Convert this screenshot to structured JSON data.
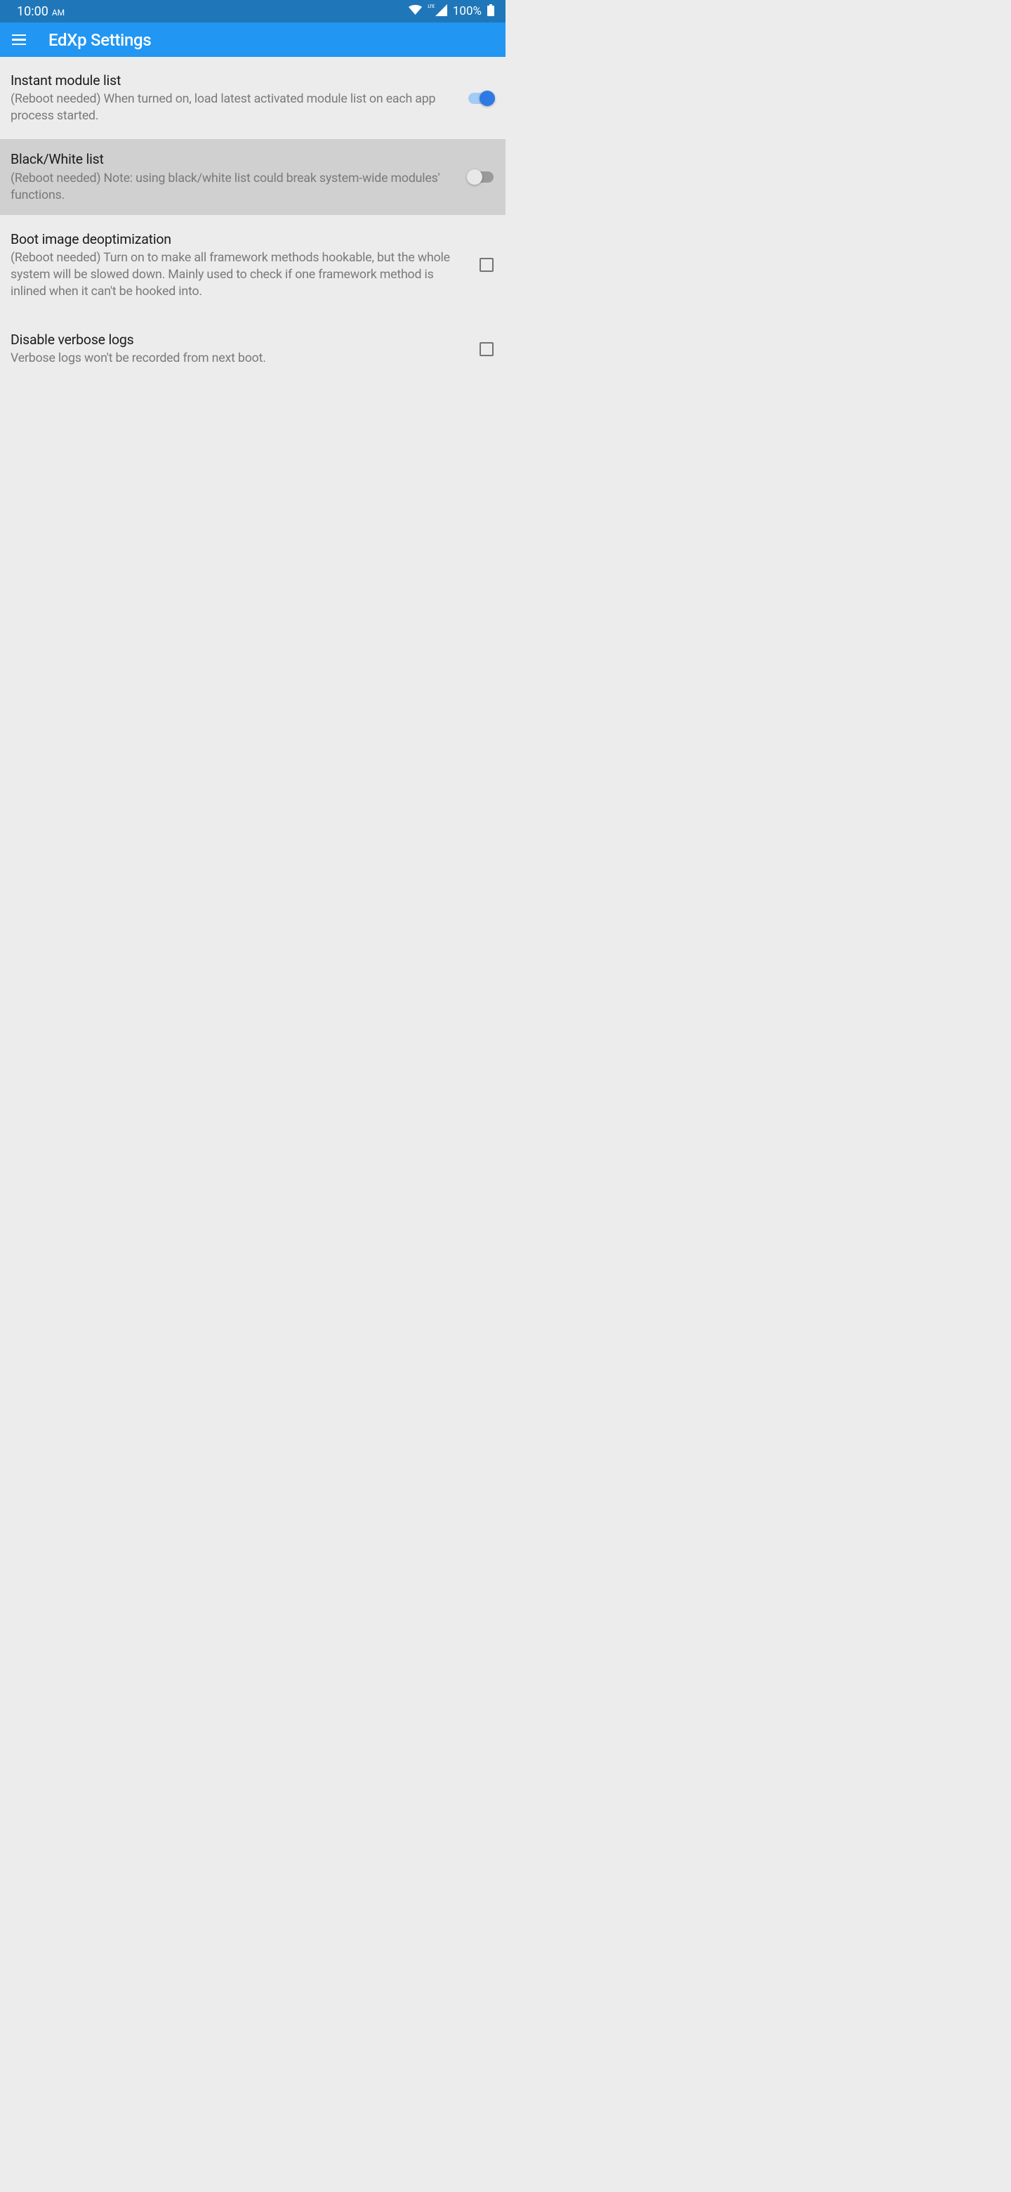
{
  "status_bar": {
    "time_hm": "10:00",
    "time_ampm": "AM",
    "network_label": "LTE",
    "battery_pct": "100%"
  },
  "app_bar": {
    "title": "EdXp Settings"
  },
  "settings": [
    {
      "title": "Instant module list",
      "desc": "(Reboot needed) When turned on, load latest activated module list on each app process started.",
      "control": "switch",
      "value": true
    },
    {
      "title": "Black/White list",
      "desc": "(Reboot needed) Note: using black/white list could break system-wide modules' functions.",
      "control": "switch",
      "value": false
    },
    {
      "title": "Boot image deoptimization",
      "desc": "(Reboot needed) Turn on to make all framework methods hookable, but the whole system will be slowed down. Mainly used to check if one framework method is inlined when it can't be hooked into.",
      "control": "checkbox",
      "value": false
    },
    {
      "title": "Disable verbose logs",
      "desc": "Verbose logs won't be recorded from next boot.",
      "control": "checkbox",
      "value": false
    }
  ]
}
